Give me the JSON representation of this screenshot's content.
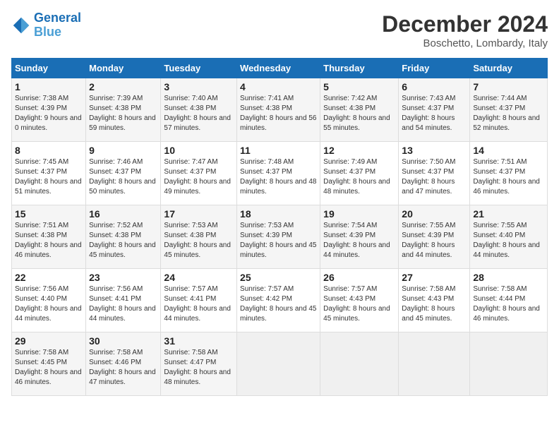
{
  "header": {
    "logo_line1": "General",
    "logo_line2": "Blue",
    "title": "December 2024",
    "subtitle": "Boschetto, Lombardy, Italy"
  },
  "days_of_week": [
    "Sunday",
    "Monday",
    "Tuesday",
    "Wednesday",
    "Thursday",
    "Friday",
    "Saturday"
  ],
  "weeks": [
    [
      {
        "day": 1,
        "sunrise": "7:38 AM",
        "sunset": "4:39 PM",
        "daylight": "9 hours and 0 minutes."
      },
      {
        "day": 2,
        "sunrise": "7:39 AM",
        "sunset": "4:38 PM",
        "daylight": "8 hours and 59 minutes."
      },
      {
        "day": 3,
        "sunrise": "7:40 AM",
        "sunset": "4:38 PM",
        "daylight": "8 hours and 57 minutes."
      },
      {
        "day": 4,
        "sunrise": "7:41 AM",
        "sunset": "4:38 PM",
        "daylight": "8 hours and 56 minutes."
      },
      {
        "day": 5,
        "sunrise": "7:42 AM",
        "sunset": "4:38 PM",
        "daylight": "8 hours and 55 minutes."
      },
      {
        "day": 6,
        "sunrise": "7:43 AM",
        "sunset": "4:37 PM",
        "daylight": "8 hours and 54 minutes."
      },
      {
        "day": 7,
        "sunrise": "7:44 AM",
        "sunset": "4:37 PM",
        "daylight": "8 hours and 52 minutes."
      }
    ],
    [
      {
        "day": 8,
        "sunrise": "7:45 AM",
        "sunset": "4:37 PM",
        "daylight": "8 hours and 51 minutes."
      },
      {
        "day": 9,
        "sunrise": "7:46 AM",
        "sunset": "4:37 PM",
        "daylight": "8 hours and 50 minutes."
      },
      {
        "day": 10,
        "sunrise": "7:47 AM",
        "sunset": "4:37 PM",
        "daylight": "8 hours and 49 minutes."
      },
      {
        "day": 11,
        "sunrise": "7:48 AM",
        "sunset": "4:37 PM",
        "daylight": "8 hours and 48 minutes."
      },
      {
        "day": 12,
        "sunrise": "7:49 AM",
        "sunset": "4:37 PM",
        "daylight": "8 hours and 48 minutes."
      },
      {
        "day": 13,
        "sunrise": "7:50 AM",
        "sunset": "4:37 PM",
        "daylight": "8 hours and 47 minutes."
      },
      {
        "day": 14,
        "sunrise": "7:51 AM",
        "sunset": "4:37 PM",
        "daylight": "8 hours and 46 minutes."
      }
    ],
    [
      {
        "day": 15,
        "sunrise": "7:51 AM",
        "sunset": "4:38 PM",
        "daylight": "8 hours and 46 minutes."
      },
      {
        "day": 16,
        "sunrise": "7:52 AM",
        "sunset": "4:38 PM",
        "daylight": "8 hours and 45 minutes."
      },
      {
        "day": 17,
        "sunrise": "7:53 AM",
        "sunset": "4:38 PM",
        "daylight": "8 hours and 45 minutes."
      },
      {
        "day": 18,
        "sunrise": "7:53 AM",
        "sunset": "4:39 PM",
        "daylight": "8 hours and 45 minutes."
      },
      {
        "day": 19,
        "sunrise": "7:54 AM",
        "sunset": "4:39 PM",
        "daylight": "8 hours and 44 minutes."
      },
      {
        "day": 20,
        "sunrise": "7:55 AM",
        "sunset": "4:39 PM",
        "daylight": "8 hours and 44 minutes."
      },
      {
        "day": 21,
        "sunrise": "7:55 AM",
        "sunset": "4:40 PM",
        "daylight": "8 hours and 44 minutes."
      }
    ],
    [
      {
        "day": 22,
        "sunrise": "7:56 AM",
        "sunset": "4:40 PM",
        "daylight": "8 hours and 44 minutes."
      },
      {
        "day": 23,
        "sunrise": "7:56 AM",
        "sunset": "4:41 PM",
        "daylight": "8 hours and 44 minutes."
      },
      {
        "day": 24,
        "sunrise": "7:57 AM",
        "sunset": "4:41 PM",
        "daylight": "8 hours and 44 minutes."
      },
      {
        "day": 25,
        "sunrise": "7:57 AM",
        "sunset": "4:42 PM",
        "daylight": "8 hours and 45 minutes."
      },
      {
        "day": 26,
        "sunrise": "7:57 AM",
        "sunset": "4:43 PM",
        "daylight": "8 hours and 45 minutes."
      },
      {
        "day": 27,
        "sunrise": "7:58 AM",
        "sunset": "4:43 PM",
        "daylight": "8 hours and 45 minutes."
      },
      {
        "day": 28,
        "sunrise": "7:58 AM",
        "sunset": "4:44 PM",
        "daylight": "8 hours and 46 minutes."
      }
    ],
    [
      {
        "day": 29,
        "sunrise": "7:58 AM",
        "sunset": "4:45 PM",
        "daylight": "8 hours and 46 minutes."
      },
      {
        "day": 30,
        "sunrise": "7:58 AM",
        "sunset": "4:46 PM",
        "daylight": "8 hours and 47 minutes."
      },
      {
        "day": 31,
        "sunrise": "7:58 AM",
        "sunset": "4:47 PM",
        "daylight": "8 hours and 48 minutes."
      },
      null,
      null,
      null,
      null
    ]
  ]
}
